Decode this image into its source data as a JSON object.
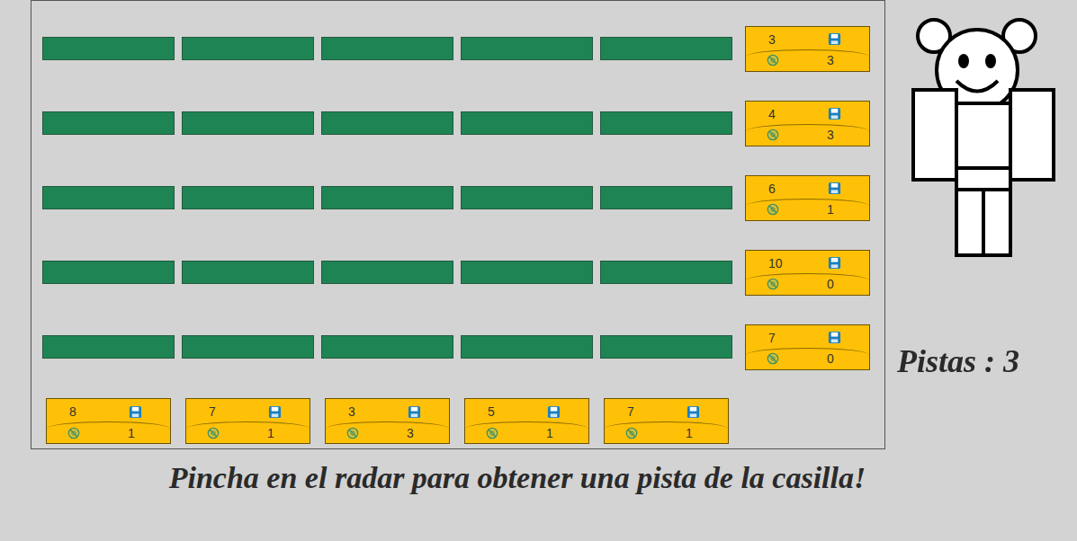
{
  "board": {
    "rows": [
      {
        "tiles": [
          {
            "revealed": false
          },
          {
            "revealed": false
          },
          {
            "revealed": false
          },
          {
            "revealed": false
          },
          {
            "revealed": false
          }
        ],
        "clue": {
          "sum": "3",
          "voltorbs": "3"
        }
      },
      {
        "tiles": [
          {
            "revealed": false
          },
          {
            "revealed": false
          },
          {
            "revealed": false
          },
          {
            "revealed": false
          },
          {
            "revealed": false
          }
        ],
        "clue": {
          "sum": "4",
          "voltorbs": "3"
        }
      },
      {
        "tiles": [
          {
            "revealed": false
          },
          {
            "revealed": false
          },
          {
            "revealed": false
          },
          {
            "revealed": false
          },
          {
            "revealed": false
          }
        ],
        "clue": {
          "sum": "6",
          "voltorbs": "1"
        }
      },
      {
        "tiles": [
          {
            "revealed": false
          },
          {
            "revealed": false
          },
          {
            "revealed": false
          },
          {
            "revealed": false
          },
          {
            "revealed": false
          }
        ],
        "clue": {
          "sum": "10",
          "voltorbs": "0"
        }
      },
      {
        "tiles": [
          {
            "revealed": false
          },
          {
            "revealed": false
          },
          {
            "revealed": false
          },
          {
            "revealed": false
          },
          {
            "revealed": false
          }
        ],
        "clue": {
          "sum": "7",
          "voltorbs": "0"
        }
      }
    ],
    "column_clues": [
      {
        "sum": "8",
        "voltorbs": "1"
      },
      {
        "sum": "7",
        "voltorbs": "1"
      },
      {
        "sum": "3",
        "voltorbs": "3"
      },
      {
        "sum": "5",
        "voltorbs": "1"
      },
      {
        "sum": "7",
        "voltorbs": "1"
      }
    ]
  },
  "hints": {
    "label": "Pistas : 3"
  },
  "footer": "Pincha en el radar para obtener una pista de la casilla!"
}
